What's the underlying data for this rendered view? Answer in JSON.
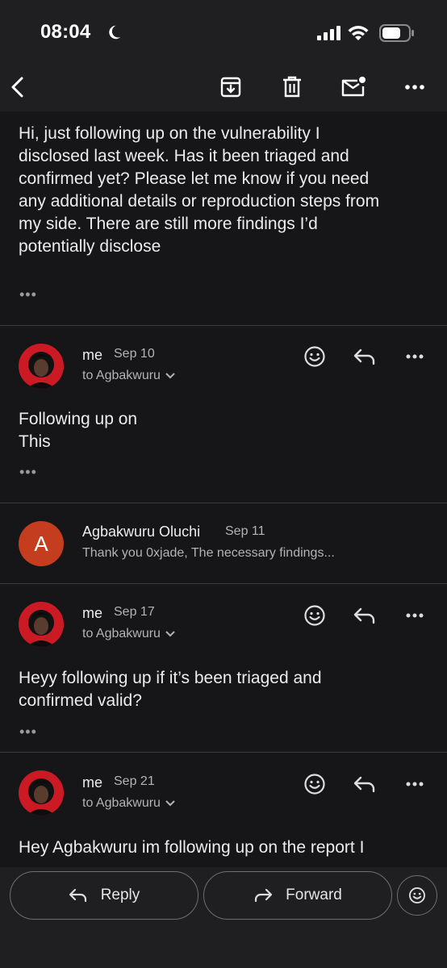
{
  "status_bar": {
    "time": "08:04"
  },
  "icons": {
    "moon": "moon-icon",
    "signal": "signal-icon",
    "wifi": "wifi-icon",
    "battery": "battery-icon",
    "back": "back-arrow-icon",
    "archive": "archive-icon",
    "delete": "trash-icon",
    "mark_unread": "mark-unread-icon",
    "more": "more-icon",
    "emoji": "emoji-icon",
    "reply": "reply-icon",
    "forward": "forward-icon"
  },
  "colors": {
    "background": "#1f1f21",
    "card": "#161618",
    "avatar_letter_bg": "#c53d1f"
  },
  "messages": [
    {
      "body": "Hi, just following up on the vulnerability I\ndisclosed last week. Has it been triaged and\nconfirmed yet? Please let me know if you need\nany additional details or reproduction steps from\nmy side. There are still more findings I’d\npotentially disclose",
      "more_dots": "•••"
    },
    {
      "sender": "me",
      "date": "Sep 10",
      "to": "to Agbakwuru",
      "body": "Following up on\nThis",
      "more_dots": "•••"
    },
    {
      "sender": "Agbakwuru Oluchi",
      "avatar_letter": "A",
      "date": "Sep 11",
      "snippet": "Thank you 0xjade, The necessary findings..."
    },
    {
      "sender": "me",
      "date": "Sep 17",
      "to": "to Agbakwuru",
      "body": "Heyy following up if it’s been triaged and\nconfirmed valid?",
      "more_dots": "•••"
    },
    {
      "sender": "me",
      "date": "Sep 21",
      "to": "to Agbakwuru",
      "body": "Hey Agbakwuru im following up on the report I"
    }
  ],
  "bottom": {
    "reply_label": "Reply",
    "forward_label": "Forward"
  }
}
